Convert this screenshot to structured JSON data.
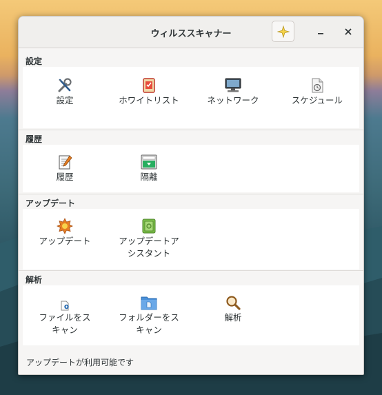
{
  "window": {
    "title": "ウィルススキャナー"
  },
  "sections": {
    "settings": {
      "header": "設定",
      "items": [
        {
          "label": "設定",
          "icon": "tools-icon"
        },
        {
          "label": "ホワイトリスト",
          "icon": "whitelist-icon"
        },
        {
          "label": "ネットワーク",
          "icon": "network-icon"
        },
        {
          "label": "スケジュール",
          "icon": "schedule-icon"
        }
      ]
    },
    "history": {
      "header": "履歴",
      "items": [
        {
          "label": "履歴",
          "icon": "history-icon"
        },
        {
          "label": "隔離",
          "icon": "quarantine-icon"
        }
      ]
    },
    "update": {
      "header": "アップデート",
      "items": [
        {
          "label": "アップデート",
          "icon": "update-icon"
        },
        {
          "label_line1": "アップデートア",
          "label_line2": "シスタント",
          "icon": "update-assistant-icon"
        }
      ]
    },
    "analysis": {
      "header": "解析",
      "items": [
        {
          "label_line1": "ファイルをス",
          "label_line2": "キャン",
          "icon": "scan-file-icon"
        },
        {
          "label_line1": "フォルダーをス",
          "label_line2": "キャン",
          "icon": "scan-folder-icon"
        },
        {
          "label": "解析",
          "icon": "analysis-icon"
        }
      ]
    }
  },
  "status_bar": {
    "text": "アップデートが利用可能です"
  }
}
